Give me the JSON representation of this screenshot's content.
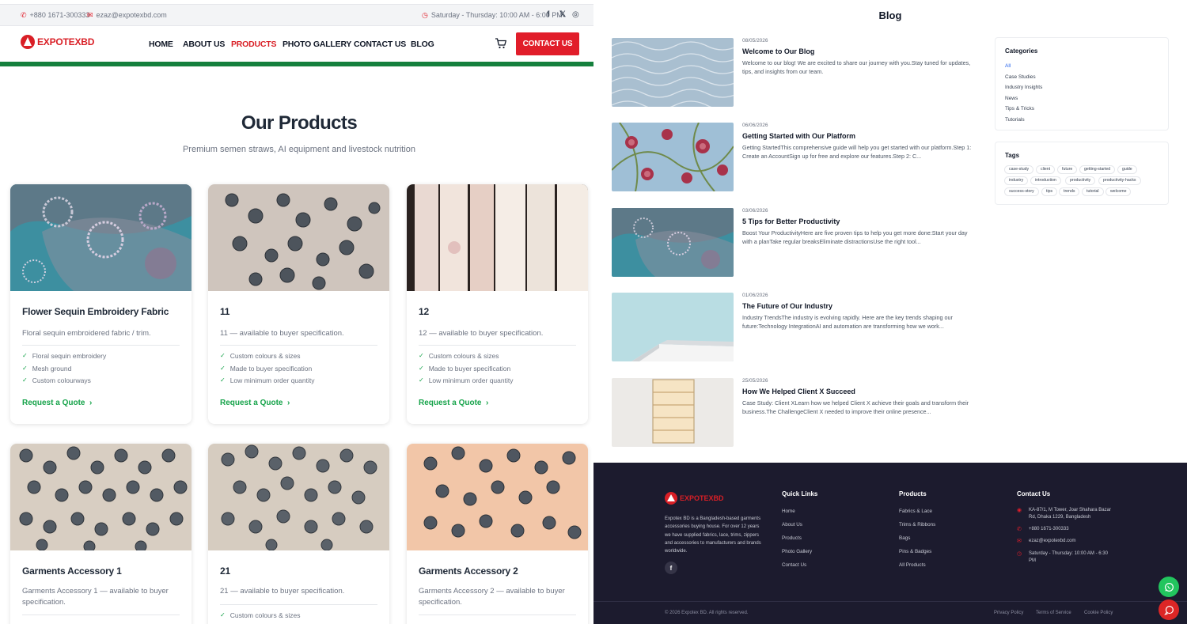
{
  "left": {
    "topbar": {
      "phone": "+880 1671-300333",
      "email": "ezaz@expotexbd.com",
      "hours": "Saturday - Thursday: 10:00 AM - 6:00 PM"
    },
    "header": {
      "logo_text": "EXPOTEXBD",
      "nav": [
        "HOME",
        "ABOUT US",
        "PRODUCTS",
        "PHOTO GALLERY",
        "CONTACT US",
        "BLOG"
      ],
      "active_nav": "PRODUCTS",
      "cta": "CONTACT US"
    },
    "section": {
      "title": "Our Products",
      "subtitle": "Premium semen straws, AI equipment and livestock nutrition"
    },
    "cards": [
      {
        "title": "Flower Sequin Embroidery Fabric",
        "desc": "Floral sequin embroidered fabric / trim.",
        "features": [
          "Floral sequin embroidery",
          "Mesh ground",
          "Custom colourways"
        ],
        "cta": "Request a Quote"
      },
      {
        "title": "11",
        "desc": "11 — available to buyer specification.",
        "features": [
          "Custom colours & sizes",
          "Made to buyer specification",
          "Low minimum order quantity"
        ],
        "cta": "Request a Quote"
      },
      {
        "title": "12",
        "desc": "12 — available to buyer specification.",
        "features": [
          "Custom colours & sizes",
          "Made to buyer specification",
          "Low minimum order quantity"
        ],
        "cta": "Request a Quote"
      },
      {
        "title": "Garments Accessory 1",
        "desc": "Garments Accessory 1 — available to buyer specification.",
        "features": []
      },
      {
        "title": "21",
        "desc": "21 — available to buyer specification.",
        "features": [
          "Custom colours & sizes"
        ]
      },
      {
        "title": "Garments Accessory 2",
        "desc": "Garments Accessory 2 — available to buyer specification.",
        "features": []
      }
    ]
  },
  "right": {
    "title": "Blog",
    "posts": [
      {
        "date": "08/05/2026",
        "title": "Welcome to Our Blog",
        "excerpt": "Welcome to our blog! We are excited to share our journey with you.Stay tuned for updates, tips, and insights from our team."
      },
      {
        "date": "06/06/2026",
        "title": "Getting Started with Our Platform",
        "excerpt": "Getting StartedThis comprehensive guide will help you get started with our platform.Step 1: Create an AccountSign up for free and explore our features.Step 2: C..."
      },
      {
        "date": "03/06/2026",
        "title": "5 Tips for Better Productivity",
        "excerpt": "Boost Your ProductivityHere are five proven tips to help you get more done:Start your day with a planTake regular breaksEliminate distractionsUse the right tool..."
      },
      {
        "date": "01/06/2026",
        "title": "The Future of Our Industry",
        "excerpt": "Industry TrendsThe industry is evolving rapidly. Here are the key trends shaping our future:Technology IntegrationAI and automation are transforming how we work..."
      },
      {
        "date": "25/05/2026",
        "title": "How We Helped Client X Succeed",
        "excerpt": "Case Study: Client XLearn how we helped Client X achieve their goals and transform their business.The ChallengeClient X needed to improve their online presence..."
      }
    ],
    "categories": {
      "title": "Categories",
      "items": [
        "All",
        "Case Studies",
        "Industry Insights",
        "News",
        "Tips & Tricks",
        "Tutorials"
      ]
    },
    "tags": {
      "title": "Tags",
      "items": [
        "case-study",
        "client",
        "future",
        "getting-started",
        "guide",
        "industry",
        "introduction",
        "productivity",
        "productivity-hacks",
        "success-story",
        "tips",
        "trends",
        "tutorial",
        "welcome"
      ]
    },
    "footer": {
      "logo_text": "EXPOTEXBD",
      "about": "Expotex BD is a Bangladesh-based garments accessories buying house. For over 12 years we have supplied fabrics, lace, trims, zippers and accessories to manufacturers and brands worldwide.",
      "quick_title": "Quick Links",
      "quick": [
        "Home",
        "About Us",
        "Products",
        "Photo Gallery",
        "Contact Us"
      ],
      "products_title": "Products",
      "products": [
        "Fabrics & Lace",
        "Trims & Ribbons",
        "Bags",
        "Pins & Badges",
        "All Products"
      ],
      "contact_title": "Contact Us",
      "address": "KA-87/1, M Tower, Joar Shahara Bazar Rd, Dhaka 1229, Bangladesh",
      "phone": "+880 1671-300333",
      "email": "ezaz@expotexbd.com",
      "hours": "Saturday - Thursday: 10:00 AM - 6:30 PM",
      "copyright": "© 2026 Expotex BD. All rights reserved.",
      "legal": [
        "Privacy Policy",
        "Terms of Service",
        "Cookie Policy"
      ]
    }
  },
  "colors": {
    "brand_red": "#d91f26",
    "accent_green": "#16a34a",
    "footer_bg": "#1c1b2e"
  },
  "icons": [
    "phone-icon",
    "mail-icon",
    "clock-icon",
    "facebook-icon",
    "x-icon",
    "instagram-icon",
    "cart-icon",
    "check-icon",
    "chevron-right-icon",
    "whatsapp-icon",
    "chat-icon"
  ]
}
